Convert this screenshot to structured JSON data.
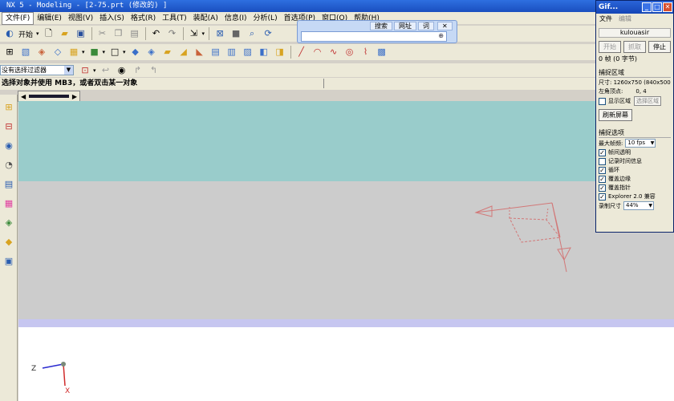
{
  "window": {
    "title": "NX 5 - Modeling - [2-75.prt  (修改的) ]"
  },
  "menu": [
    "文件(F)",
    "编辑(E)",
    "视图(V)",
    "插入(S)",
    "格式(R)",
    "工具(T)",
    "装配(A)",
    "信息(I)",
    "分析(L)",
    "首选项(P)",
    "窗口(O)",
    "帮助(H)"
  ],
  "toolbar1": {
    "start_label": "开始",
    "icons": [
      "start-icon",
      "new-file-icon",
      "open-folder-icon",
      "save-icon",
      "cut-icon",
      "copy-icon",
      "paste-icon",
      "undo-icon",
      "redo-icon",
      "select-icon",
      "fit-view-icon",
      "zoom-window-icon",
      "zoom-icon",
      "rotate-icon"
    ]
  },
  "search_popup": {
    "tab_search": "搜索",
    "tab_web": "网址",
    "tab_extra": "词"
  },
  "filter": {
    "value": "没有选择过滤器"
  },
  "cue_line": "选择对象并使用 MB3，或者双击某一对象",
  "gif_window": {
    "title": "Gif...",
    "menu_file": "文件",
    "menu_edit": "编辑",
    "user": "kulouasir",
    "btn_start": "开始",
    "btn_capture": "抓取",
    "btn_stop": "停止",
    "frames": "0 帧 (0 字节)",
    "capture_region_title": "捕捉区域",
    "size_label": "尺寸: 1260x750 (840x500",
    "corner_label": "左角顶点:",
    "corner_value": "0, 4",
    "show_region": "显示区域",
    "select_region": "选择区域",
    "refresh": "刷新屏幕",
    "options_title": "捕捉选项",
    "max_fps_label": "最大帧频:",
    "max_fps_value": "10 fps",
    "opt_transparent": "帧间透明",
    "opt_timeinfo": "记录时间信息",
    "opt_loop": "循环",
    "opt_cover_border": "覆盖边缘",
    "opt_cover_pointer": "覆盖指针",
    "opt_explorer": "Explorer 2.0 兼容",
    "record_size_label": "录制尺寸",
    "record_size_value": "44%"
  },
  "axes": {
    "z_label": "Z",
    "x_label": "X"
  },
  "colors": {
    "viewport_top": "#99cccb",
    "viewport_mid": "#cccccc",
    "viewport_band": "#c6c6f0",
    "wcs_color": "#d27878"
  }
}
